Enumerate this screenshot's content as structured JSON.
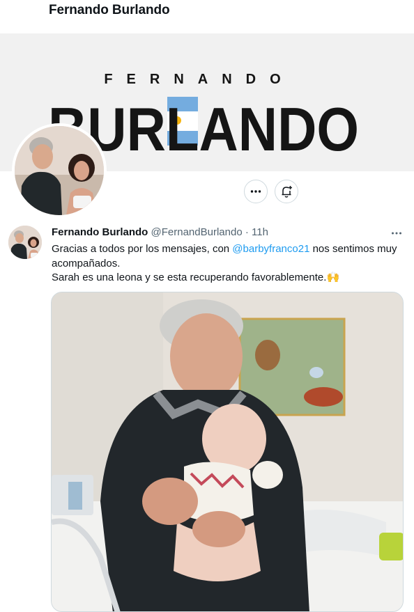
{
  "header": {
    "title": "Fernando Burlando"
  },
  "banner": {
    "line1": "FERNANDO",
    "line2": "BURLANDO",
    "colors": {
      "background": "#f1f1f1",
      "text": "#151515",
      "flag_blue": "#74acdf",
      "sun": "#f6b40e"
    }
  },
  "profile_actions": {
    "more_icon": "more-horizontal-icon",
    "notify_icon": "bell-plus-icon"
  },
  "tweet": {
    "author_name": "Fernando Burlando",
    "handle": "@FernandBurlando",
    "separator": "·",
    "time": "11h",
    "text_before_mention": "Gracias a todos por los mensajes, con ",
    "mention": "@barbyfranco21",
    "text_after_mention": " nos sentimos muy acompañados.",
    "text_line2": "Sarah es una leona y se esta recuperando favorablemente.",
    "emoji": "🙌",
    "media_description_icon": "photo"
  },
  "colors": {
    "link": "#1d9bf0",
    "secondary_text": "#536471",
    "border": "#cfd9de"
  }
}
